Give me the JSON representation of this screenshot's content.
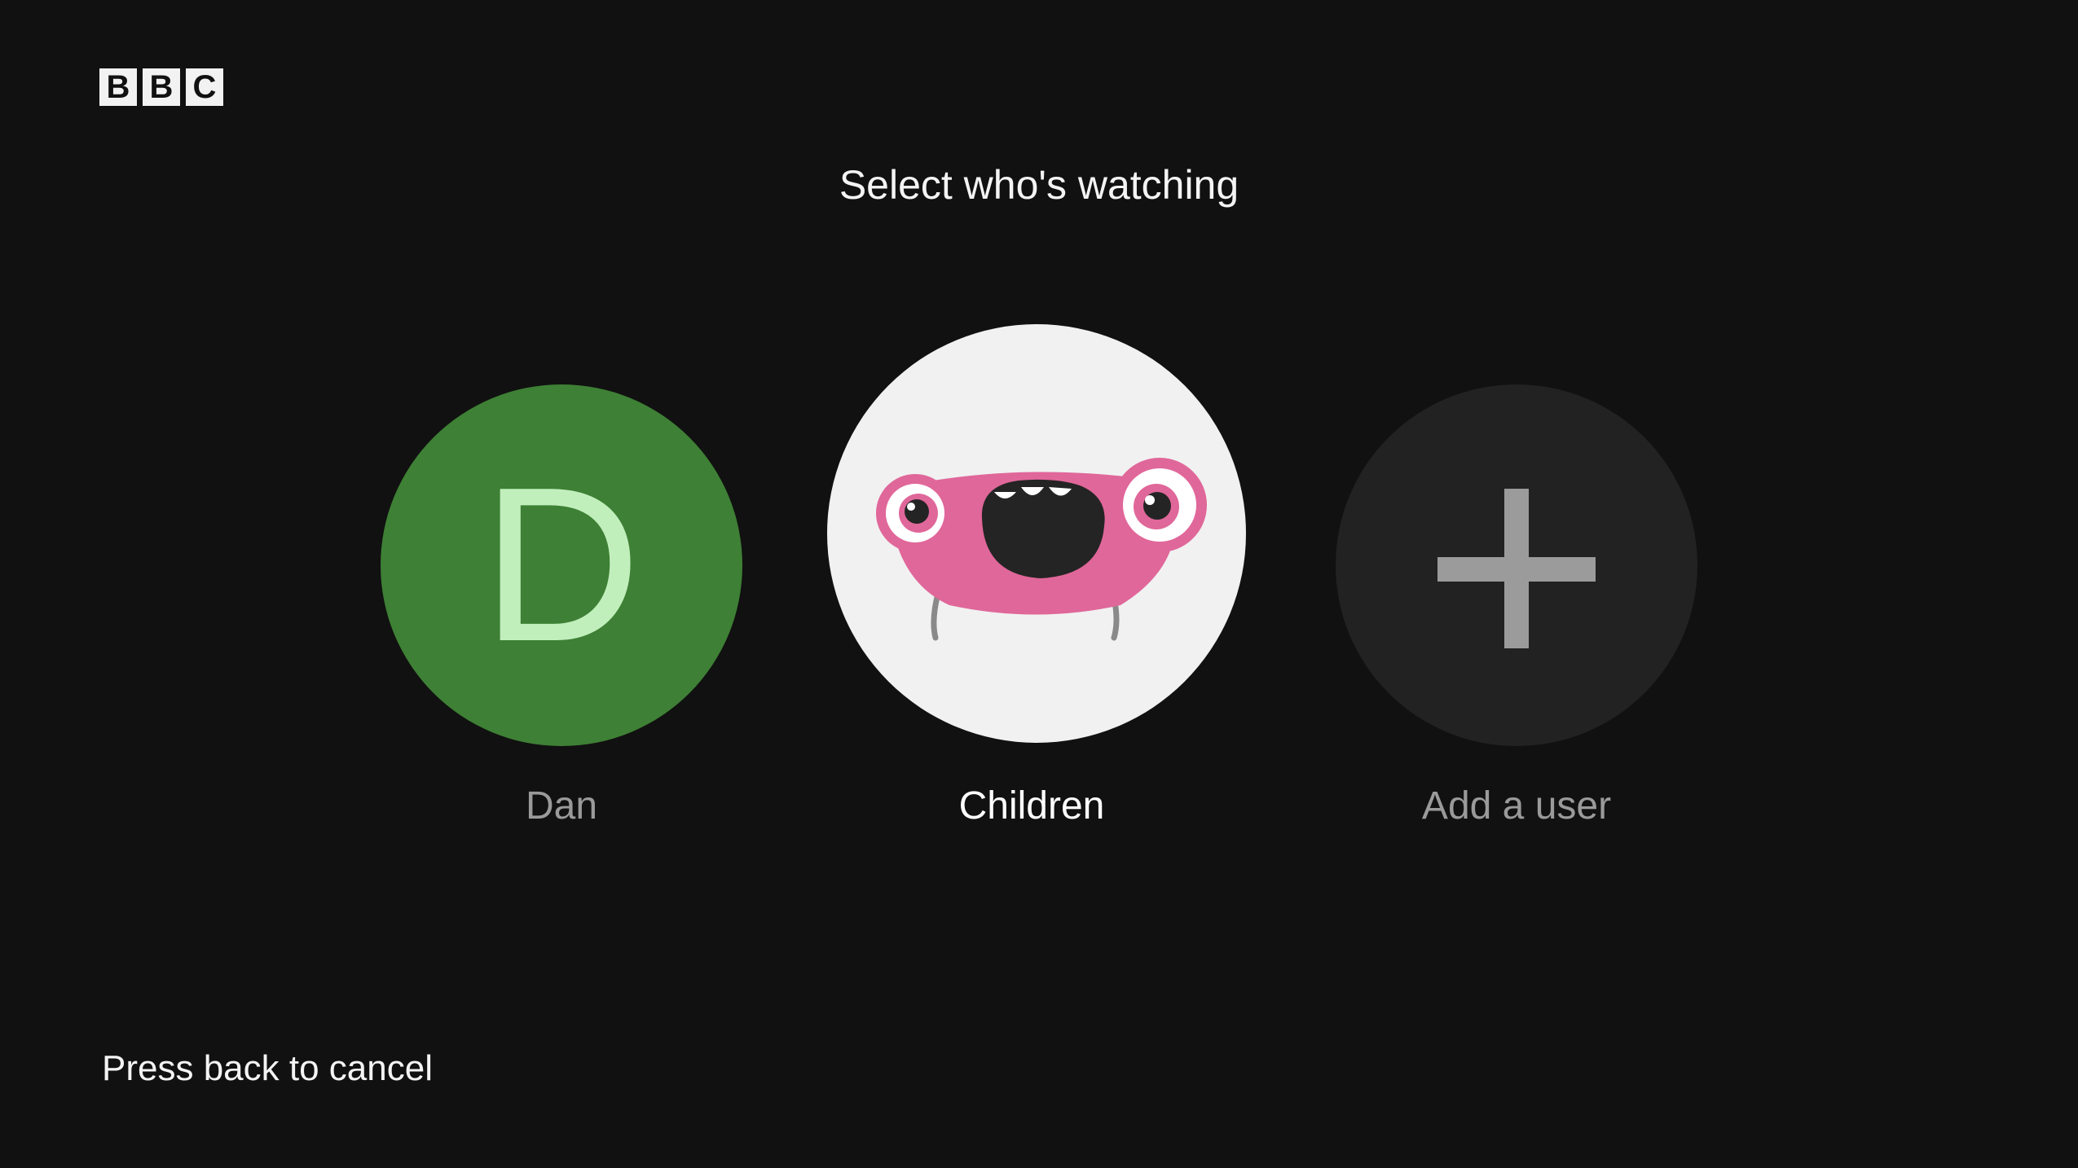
{
  "brand": {
    "logo_letters": [
      "B",
      "B",
      "C"
    ]
  },
  "page": {
    "title": "Select who's watching",
    "footer_hint": "Press back to cancel"
  },
  "profiles": [
    {
      "name": "Dan",
      "initial": "D",
      "avatar_color": "#3e8035",
      "initial_color": "#c1efbc"
    },
    {
      "name": "Children",
      "avatar": "monster-icon",
      "avatar_color": "#f1f1f1",
      "selected": true
    },
    {
      "name": "Add a user",
      "avatar": "plus-icon",
      "avatar_color": "#222222"
    }
  ],
  "colors": {
    "background": "#111111",
    "text_primary": "#ffffff",
    "text_muted": "#9a9a9a",
    "monster_pink": "#e0679a"
  }
}
